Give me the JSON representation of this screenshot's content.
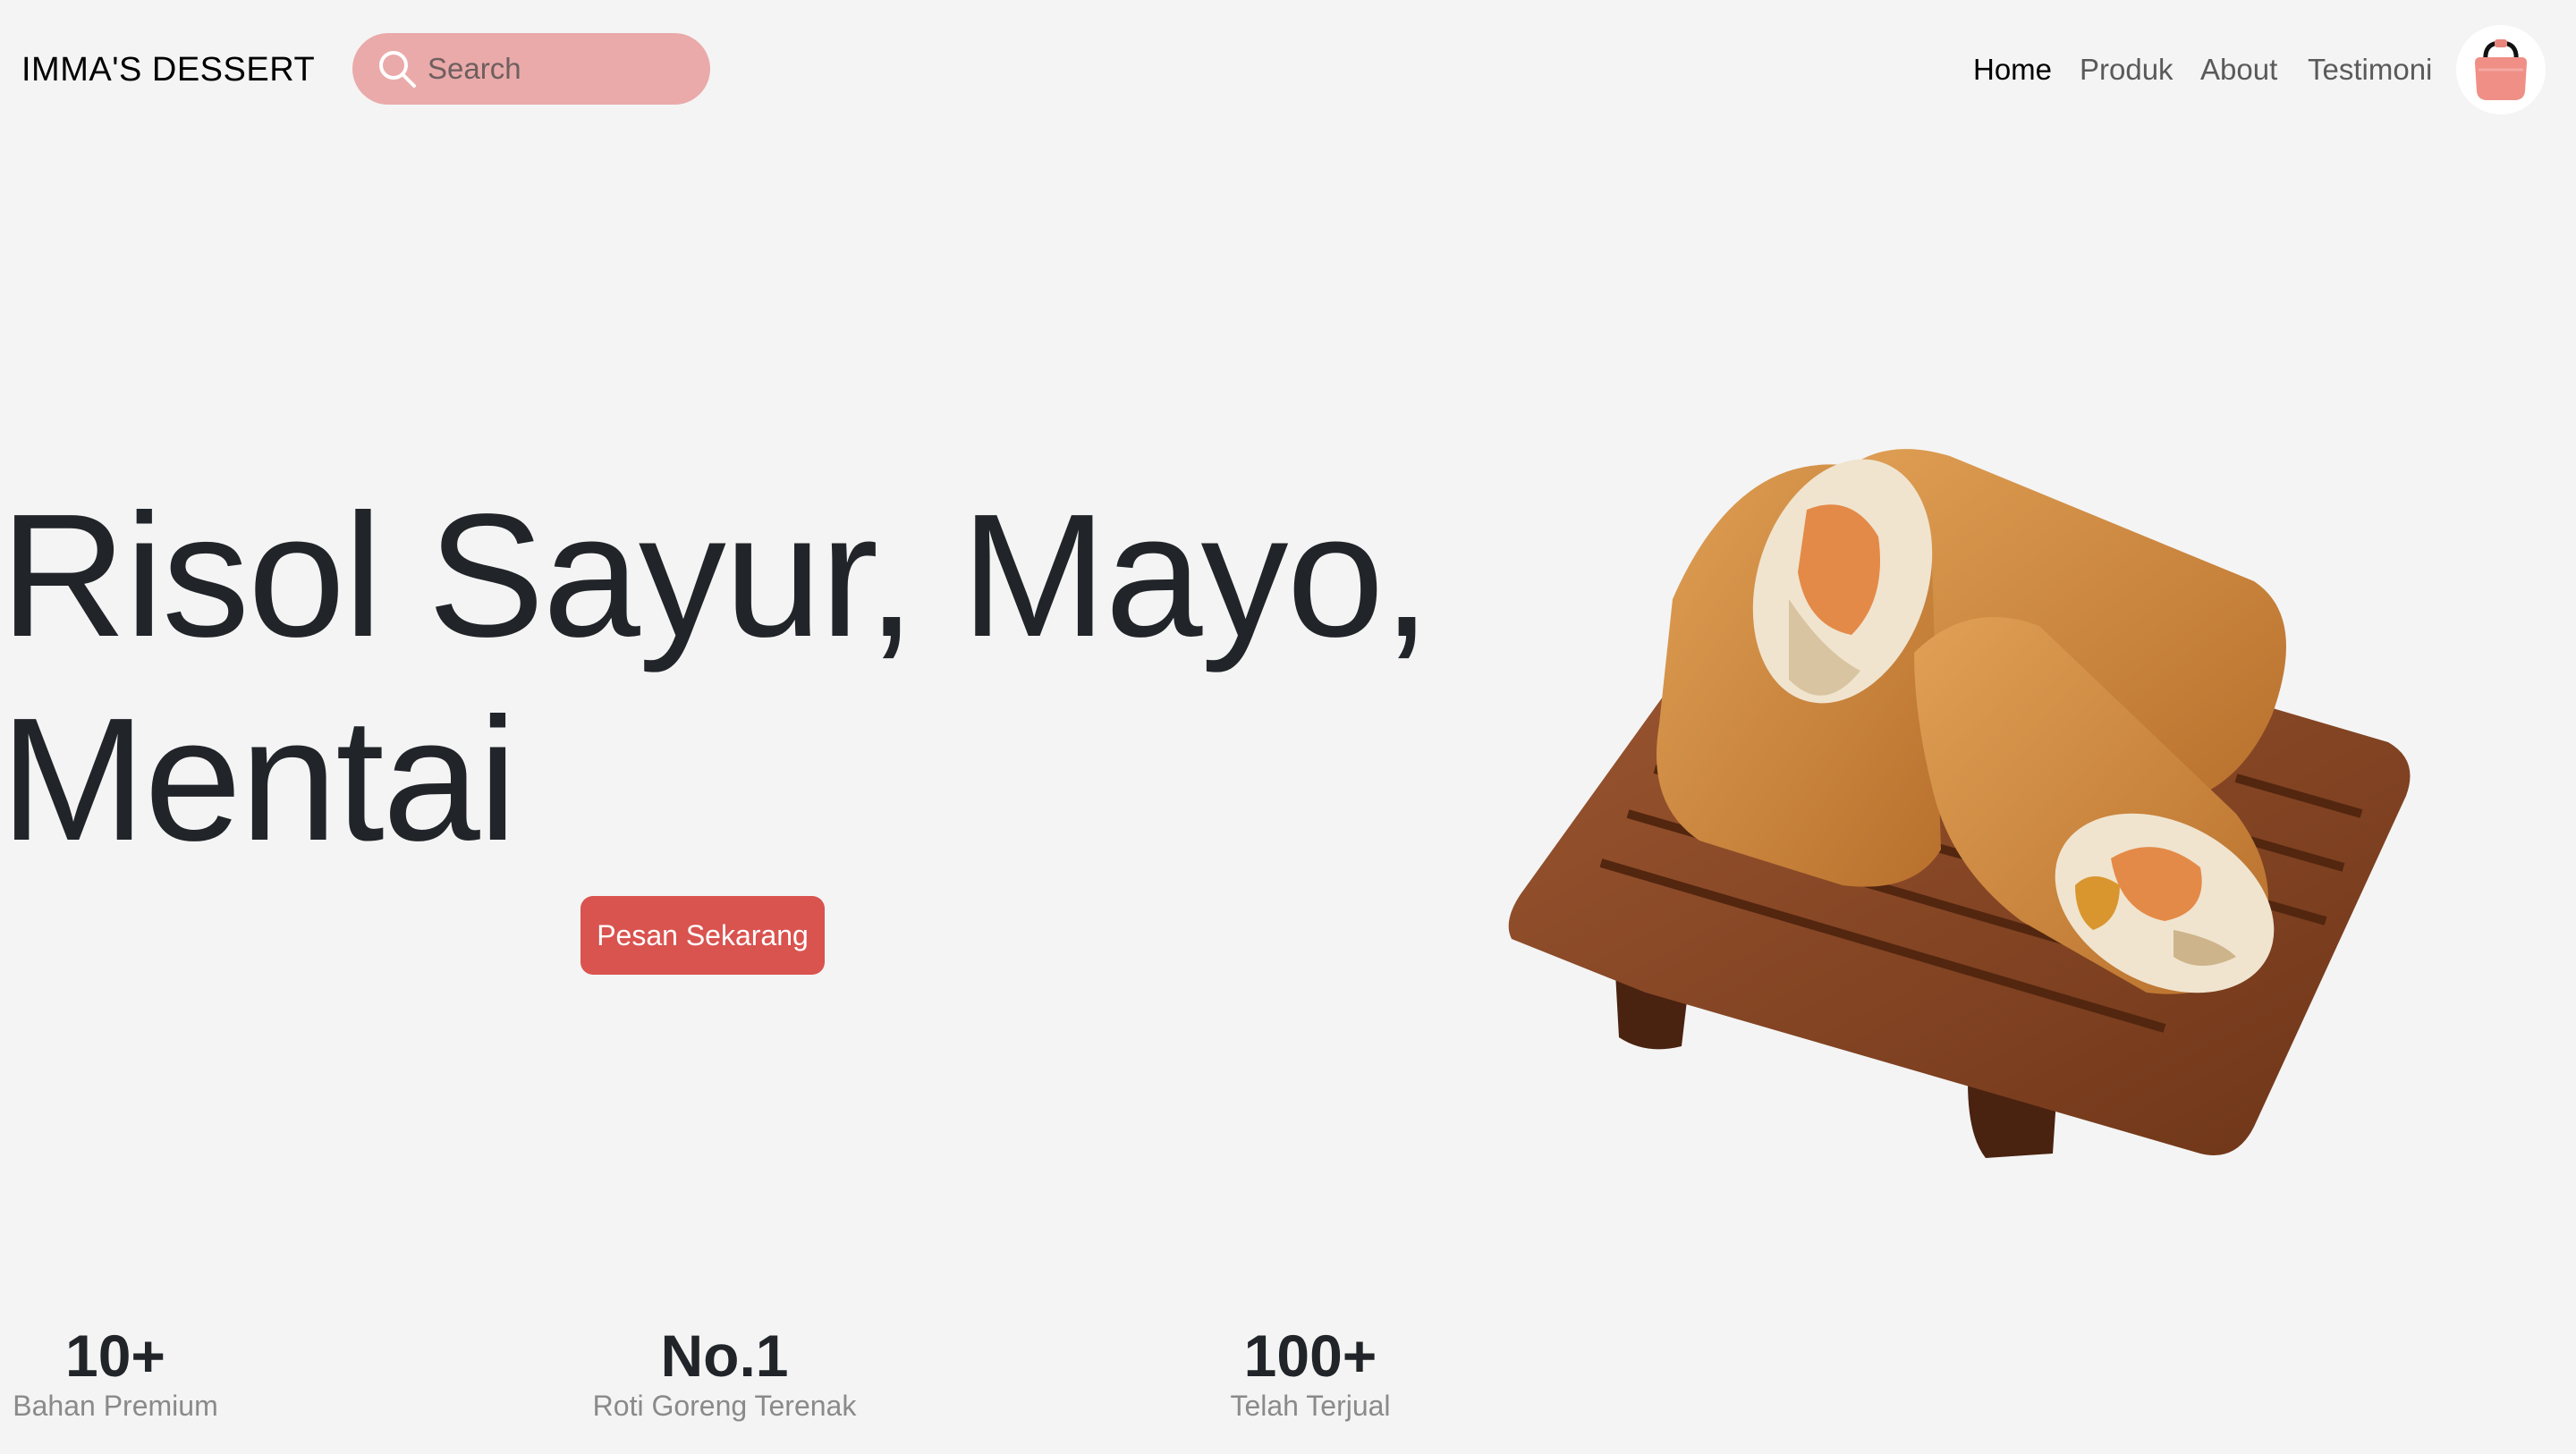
{
  "nav": {
    "brand": "IMMA'S DESSERT",
    "search_placeholder": "Search",
    "links": [
      {
        "label": "Home",
        "active": true
      },
      {
        "label": "Produk",
        "active": false
      },
      {
        "label": "About",
        "active": false
      },
      {
        "label": "Testimoni",
        "active": false
      }
    ],
    "search_icon": "search-icon",
    "cart_icon": "shopping-basket-icon"
  },
  "hero": {
    "title_line1": "Risol Sayur, Mayo,",
    "title_line2": "Mentai",
    "cta_label": "Pesan Sekarang",
    "image": "fried-risoles-on-wooden-tray"
  },
  "stats": [
    {
      "value": "10+",
      "label": "Bahan Premium"
    },
    {
      "value": "No.1",
      "label": "Roti Goreng Terenak"
    },
    {
      "value": "100+",
      "label": "Telah Terjual"
    }
  ],
  "colors": {
    "background": "#f4f4f4",
    "search_bg": "#eaaaaa",
    "cta_bg": "#d9534f",
    "text_dark": "#212529",
    "text_muted": "#8a8a8a"
  }
}
